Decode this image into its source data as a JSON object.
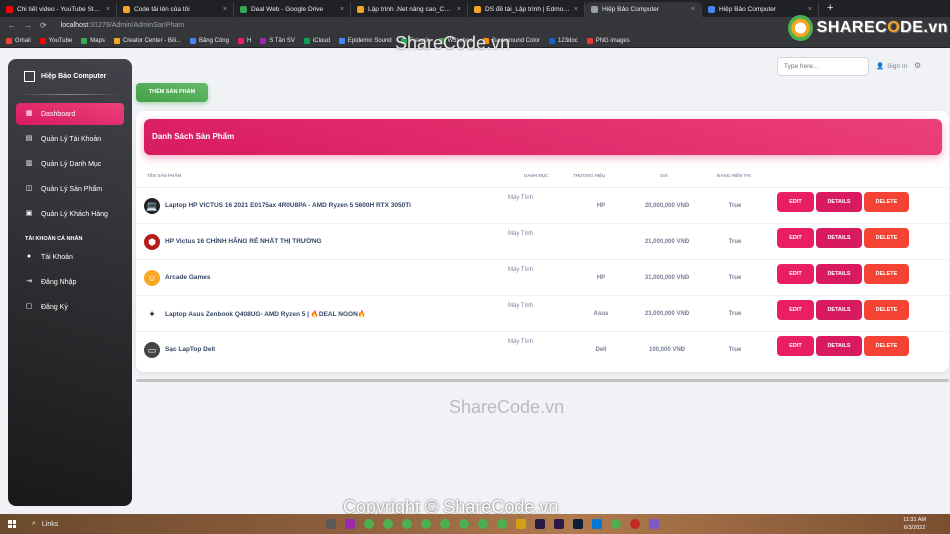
{
  "browser": {
    "tabs": [
      {
        "title": "Chi tiết video - YouTube Studio",
        "color": "#ff0000",
        "active": false
      },
      {
        "title": "Code tải lên của tôi",
        "color": "#f5a623",
        "active": false
      },
      {
        "title": "Deal Web - Google Drive",
        "color": "#34a853",
        "active": false
      },
      {
        "title": "Lập trình .Net nâng cao_CNTT1...",
        "color": "#f5a623",
        "active": false
      },
      {
        "title": "DS đề tài_Lập trình | Edmodo",
        "color": "#f5a623",
        "active": false
      },
      {
        "title": "Hiệp Bảo Computer",
        "color": "#9aa0a6",
        "active": true
      },
      {
        "title": "Hiệp Bảo Computer",
        "color": "#4285f4",
        "active": false
      }
    ],
    "url_host": "localhost",
    "url_path": ":31279/Admin/AdminSanPham",
    "bookmarks": [
      "Gmail",
      "YouTube",
      "Maps",
      "Creator Center - Bili...",
      "Bảng Công",
      "H",
      "S Tân SV",
      "iCloud",
      "Epidemic Sound",
      "Freepik",
      "W3school",
      "Background Color",
      "123doc",
      "PNG images"
    ]
  },
  "sidebar": {
    "brand": "Hiệp Bảo Computer",
    "items": [
      {
        "label": "Dashboard",
        "icon": "dashboard-icon",
        "active": true
      },
      {
        "label": "Quản Lý Tài Khoản",
        "icon": "table-icon",
        "active": false
      },
      {
        "label": "Quản Lý Danh Mục",
        "icon": "receipt-icon",
        "active": false
      },
      {
        "label": "Quản Lý Sản Phẩm",
        "icon": "view-icon",
        "active": false
      },
      {
        "label": "Quản Lý Khách Hàng",
        "icon": "notifications-icon",
        "active": false
      }
    ],
    "section_title": "TÀI KHOẢN CÁ NHÂN",
    "account_items": [
      {
        "label": "Tài Khoản",
        "icon": "person-icon"
      },
      {
        "label": "Đăng Nhập",
        "icon": "login-icon"
      },
      {
        "label": "Đăng Ký",
        "icon": "assignment-icon"
      }
    ]
  },
  "topbar": {
    "search_placeholder": "Type here...",
    "signin_label": "Sign In"
  },
  "add_button_label": "THÊM SẢN PHẨM",
  "card_title": "Danh Sách Sản Phẩm",
  "table": {
    "headers": [
      "TÊN SẢN PHẨM",
      "DANH MỤC",
      "THƯƠNG HIỆU",
      "GIÁ",
      "ĐANG HIỂN THỊ"
    ],
    "rows": [
      {
        "name": "Laptop HP VICTUS 16 2021 E0175ax 4R0U8PA - AMD Ryzen 5 5600H RTX 3050Ti",
        "category": "Máy Tính",
        "brand": "HP",
        "price": "20,000,000 VNĐ",
        "shown": "True"
      },
      {
        "name": "HP Victus 16 CHÍNH HÃNG RẺ NHẤT THỊ TRƯỜNG",
        "category": "Máy Tính",
        "brand": "",
        "price": "21,000,000 VNĐ",
        "shown": "True"
      },
      {
        "name": "Arcade Games",
        "category": "Máy Tính",
        "brand": "HP",
        "price": "31,000,000 VNĐ",
        "shown": "True"
      },
      {
        "name": "Laptop Asus Zenbook Q408UG- AMD Ryzen 5 | 🔥DEAL NGON🔥",
        "category": "Máy Tính",
        "brand": "Asus",
        "price": "23,000,000 VNĐ",
        "shown": "True"
      },
      {
        "name": "Sạc LapTop Dell",
        "category": "Máy Tính",
        "brand": "Dell",
        "price": "100,000 VNĐ",
        "shown": "True"
      }
    ],
    "actions": {
      "edit": "EDIT",
      "details": "DETAILS",
      "delete": "DELETE"
    }
  },
  "watermarks": {
    "logo_text_a": "SHAREC",
    "logo_text_o": "O",
    "logo_text_b": "DE.vn",
    "center_top": "ShareCode.vn",
    "center_mid": "ShareCode.vn",
    "bottom": "Copyright © ShareCode.vn"
  },
  "taskbar": {
    "search_label": "Links",
    "time": "11:31 AM",
    "date": "6/3/2022"
  }
}
